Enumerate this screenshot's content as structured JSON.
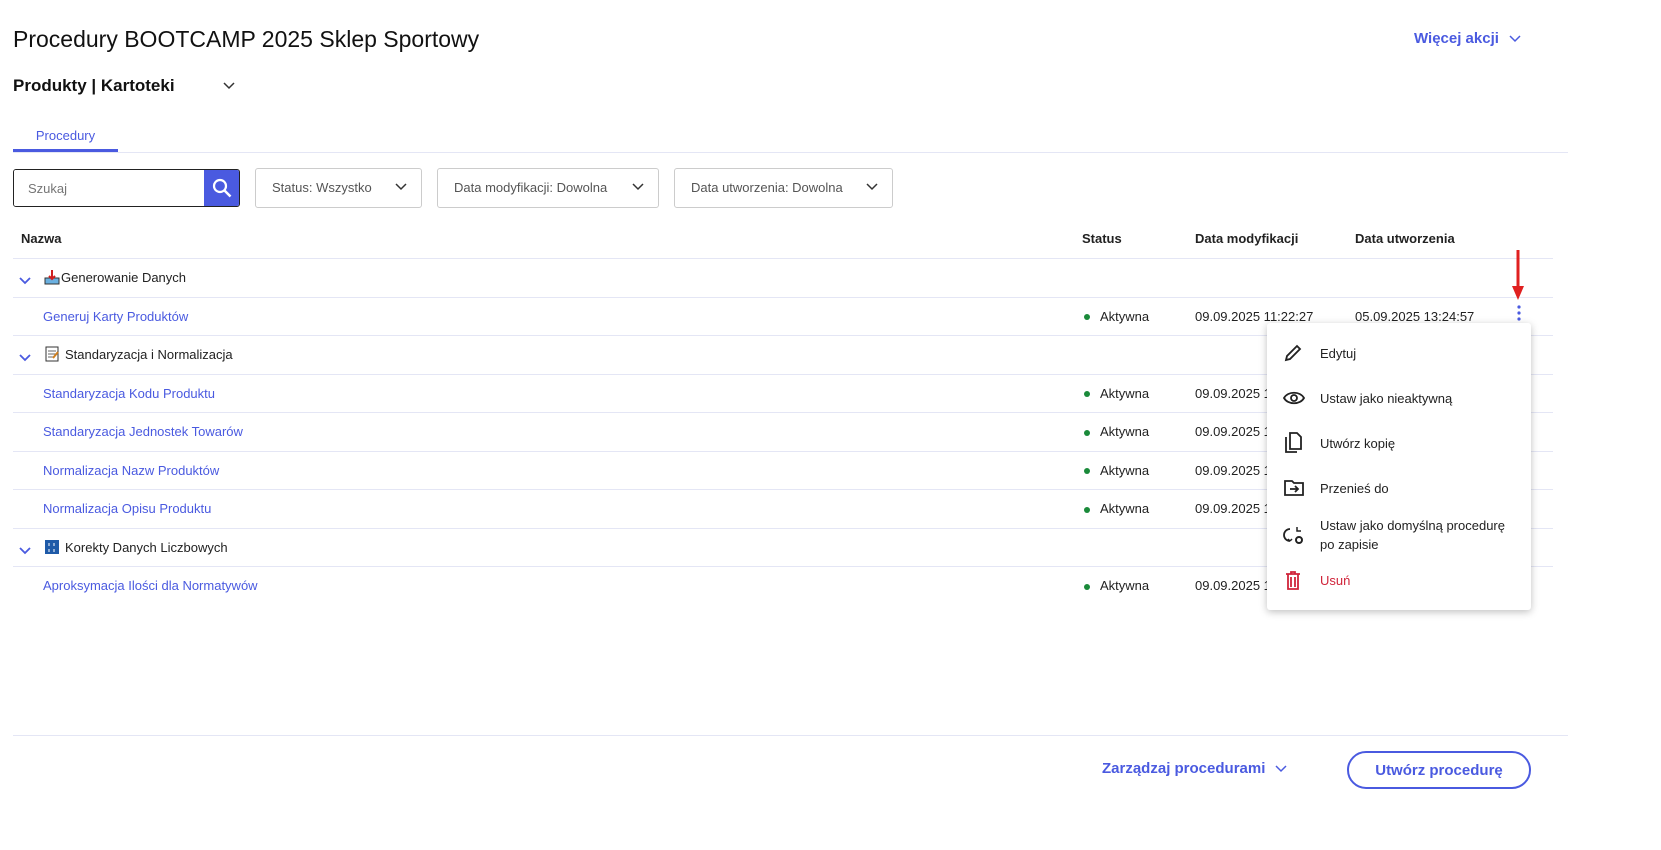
{
  "header": {
    "title": "Procedury BOOTCAMP 2025 Sklep Sportowy",
    "more_actions": "Więcej akcji",
    "subtitle": "Produkty | Kartoteki"
  },
  "tabs": [
    {
      "label": "Procedury"
    }
  ],
  "search": {
    "placeholder": "Szukaj"
  },
  "filters": [
    "Status: Wszystko",
    "Data modyfikacji: Dowolna",
    "Data utworzenia: Dowolna"
  ],
  "columns": {
    "name": "Nazwa",
    "status": "Status",
    "modified": "Data modyfikacji",
    "created": "Data utworzenia"
  },
  "groups": [
    {
      "name": "Generowanie Danych",
      "items": [
        {
          "name": "Generuj Karty Produktów",
          "status": "Aktywna",
          "modified": "09.09.2025 11:22:27",
          "created": "05.09.2025 13:24:57"
        }
      ]
    },
    {
      "name": "Standaryzacja i Normalizacja",
      "items": [
        {
          "name": "Standaryzacja Kodu Produktu",
          "status": "Aktywna",
          "modified": "09.09.2025 1"
        },
        {
          "name": "Standaryzacja Jednostek Towarów",
          "status": "Aktywna",
          "modified": "09.09.2025 1"
        },
        {
          "name": "Normalizacja Nazw Produktów",
          "status": "Aktywna",
          "modified": "09.09.2025 1"
        },
        {
          "name": "Normalizacja Opisu Produktu",
          "status": "Aktywna",
          "modified": "09.09.2025 1"
        }
      ]
    },
    {
      "name": "Korekty Danych Liczbowych",
      "items": [
        {
          "name": "Aproksymacja Ilości dla Normatywów",
          "status": "Aktywna",
          "modified": "09.09.2025 1"
        }
      ]
    }
  ],
  "context_menu": [
    "Edytuj",
    "Ustaw jako nieaktywną",
    "Utwórz kopię",
    "Przenieś do",
    "Ustaw jako domyślną procedurę po zapisie",
    "Usuń"
  ],
  "footer": {
    "manage": "Zarządzaj procedurami",
    "create": "Utwórz procedurę"
  },
  "colors": {
    "accent": "#4a5ae0",
    "active": "#1a8a3a",
    "danger": "#d0243a"
  }
}
